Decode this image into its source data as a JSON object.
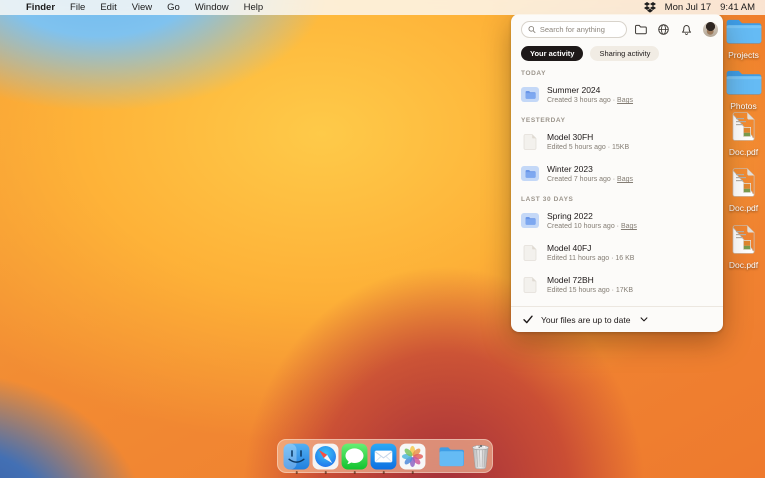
{
  "menu_bar": {
    "app_menu": "Finder",
    "menus": [
      "File",
      "Edit",
      "View",
      "Go",
      "Window",
      "Help"
    ],
    "status": {
      "date": "Mon Jul 17",
      "time": "9:41 AM"
    }
  },
  "panel": {
    "search": {
      "placeholder": "Search for anything"
    },
    "tabs": [
      {
        "label": "Your activity",
        "active": true
      },
      {
        "label": "Sharing activity",
        "active": false
      }
    ],
    "sections": [
      {
        "header": "TODAY",
        "items": [
          {
            "type": "folder",
            "title": "Summer 2024",
            "meta": "Created 3 hours ago · ",
            "link": "Bags"
          }
        ]
      },
      {
        "header": "YESTERDAY",
        "items": [
          {
            "type": "file",
            "title": "Model 30FH",
            "meta": "Edited 5 hours ago · 15KB",
            "link": ""
          },
          {
            "type": "folder",
            "title": "Winter 2023",
            "meta": "Created 7 hours ago · ",
            "link": "Bags"
          }
        ]
      },
      {
        "header": "LAST 30 DAYS",
        "items": [
          {
            "type": "folder",
            "title": "Spring 2022",
            "meta": "Created 10 hours ago · ",
            "link": "Bags"
          },
          {
            "type": "file",
            "title": "Model 40FJ",
            "meta": "Edited 11 hours ago · 16 KB",
            "link": ""
          },
          {
            "type": "file",
            "title": "Model 72BH",
            "meta": "Edited 15 hours ago · 17KB",
            "link": ""
          }
        ]
      }
    ],
    "footer": {
      "status": "Your files are up to date"
    }
  },
  "desktop": {
    "icons": [
      {
        "kind": "folder",
        "label": "Projects"
      },
      {
        "kind": "folder",
        "label": "Photos"
      },
      {
        "kind": "pdf",
        "label": "Doc.pdf"
      },
      {
        "kind": "pdf",
        "label": "Doc.pdf"
      },
      {
        "kind": "pdf",
        "label": "Doc.pdf"
      }
    ]
  },
  "dock": {
    "items": [
      {
        "name": "finder",
        "running": true
      },
      {
        "name": "safari",
        "running": true
      },
      {
        "name": "messages",
        "running": true
      },
      {
        "name": "mail",
        "running": true
      },
      {
        "name": "photos",
        "running": true
      },
      {
        "name": "divider",
        "running": false
      },
      {
        "name": "folder",
        "running": false
      },
      {
        "name": "trash",
        "running": false
      }
    ]
  },
  "colors": {
    "pill_active_bg": "#1e1919",
    "panel_bg": "#fcfbf9",
    "folder_blue": "#4a9ee8",
    "menubar_bg": "#fcfaf7"
  }
}
